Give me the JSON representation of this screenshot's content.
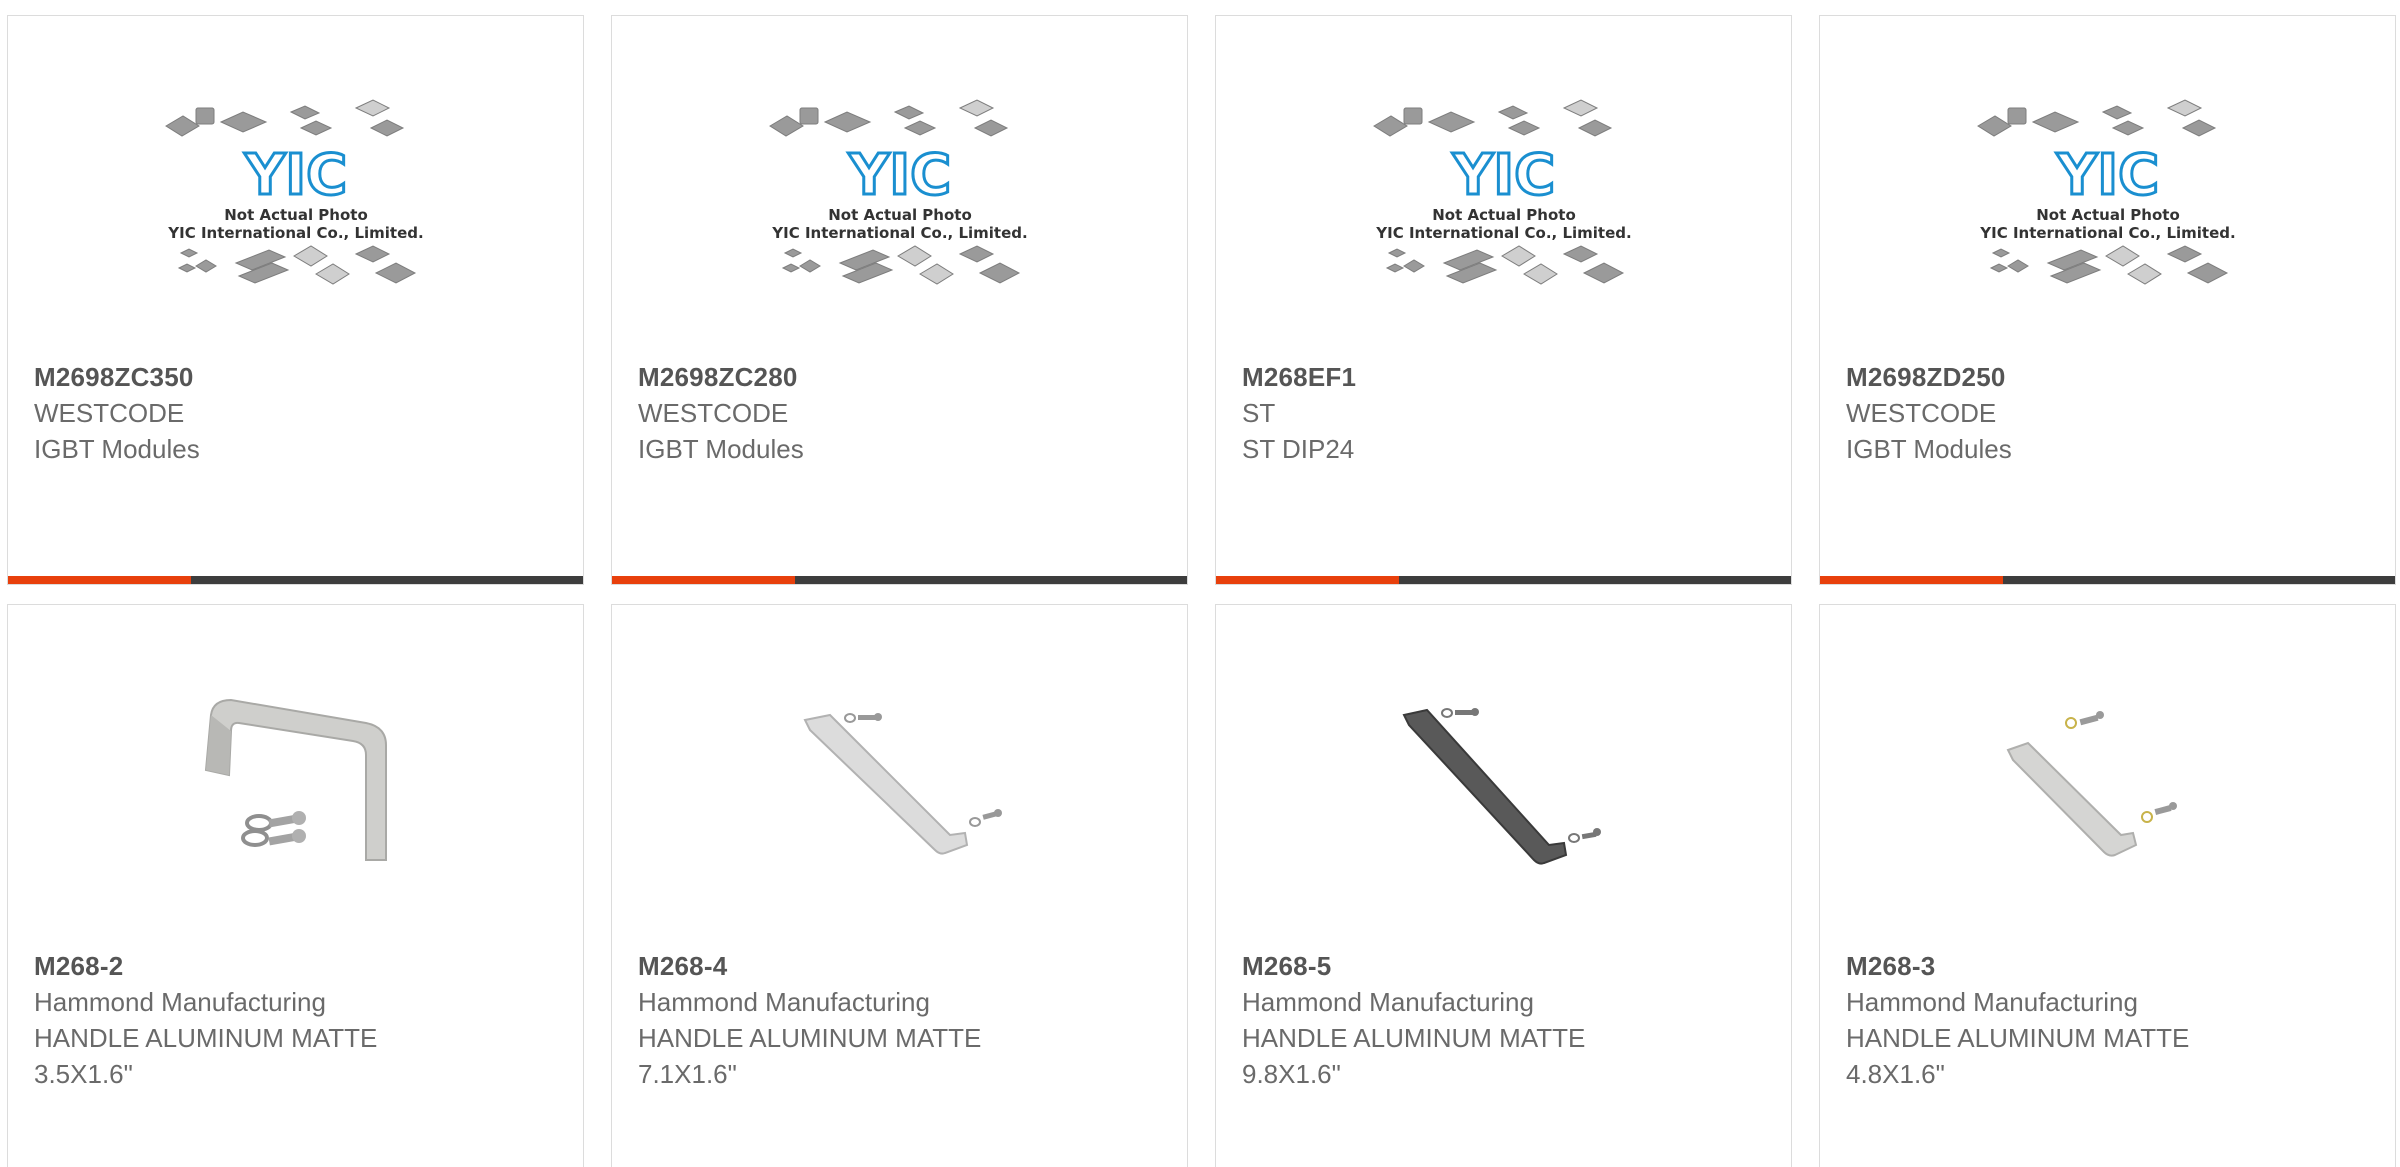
{
  "colors": {
    "accent": "#e8400c",
    "bar_dark": "#3d3d3d",
    "logo_blue": "#1a8fd0",
    "text_bold": "#555555",
    "text_regular": "#6a6a6a"
  },
  "placeholder": {
    "logo_text": "YIC",
    "line1": "Not Actual Photo",
    "line2": "YIC International Co., Limited."
  },
  "products": [
    {
      "part_number": "M2698ZC350",
      "manufacturer": "WESTCODE",
      "description": "IGBT Modules",
      "image": "yic-placeholder-photo"
    },
    {
      "part_number": "M2698ZC280",
      "manufacturer": "WESTCODE",
      "description": "IGBT Modules",
      "image": "yic-placeholder-photo"
    },
    {
      "part_number": "M268EF1",
      "manufacturer": "ST",
      "description": "ST DIP24",
      "image": "yic-placeholder-photo"
    },
    {
      "part_number": "M2698ZD250",
      "manufacturer": "WESTCODE",
      "description": "IGBT Modules",
      "image": "yic-placeholder-photo"
    },
    {
      "part_number": "M268-2",
      "manufacturer": "Hammond Manufacturing",
      "description": "HANDLE ALUMINUM MATTE\n3.5X1.6\"",
      "image": "aluminum-handle-short-photo"
    },
    {
      "part_number": "M268-4",
      "manufacturer": "Hammond Manufacturing",
      "description": "HANDLE ALUMINUM MATTE\n7.1X1.6\"",
      "image": "aluminum-handle-photo"
    },
    {
      "part_number": "M268-5",
      "manufacturer": "Hammond Manufacturing",
      "description": "HANDLE ALUMINUM MATTE\n9.8X1.6\"",
      "image": "black-handle-photo"
    },
    {
      "part_number": "M268-3",
      "manufacturer": "Hammond Manufacturing",
      "description": "HANDLE ALUMINUM MATTE\n4.8X1.6\"",
      "image": "aluminum-handle-photo"
    }
  ]
}
